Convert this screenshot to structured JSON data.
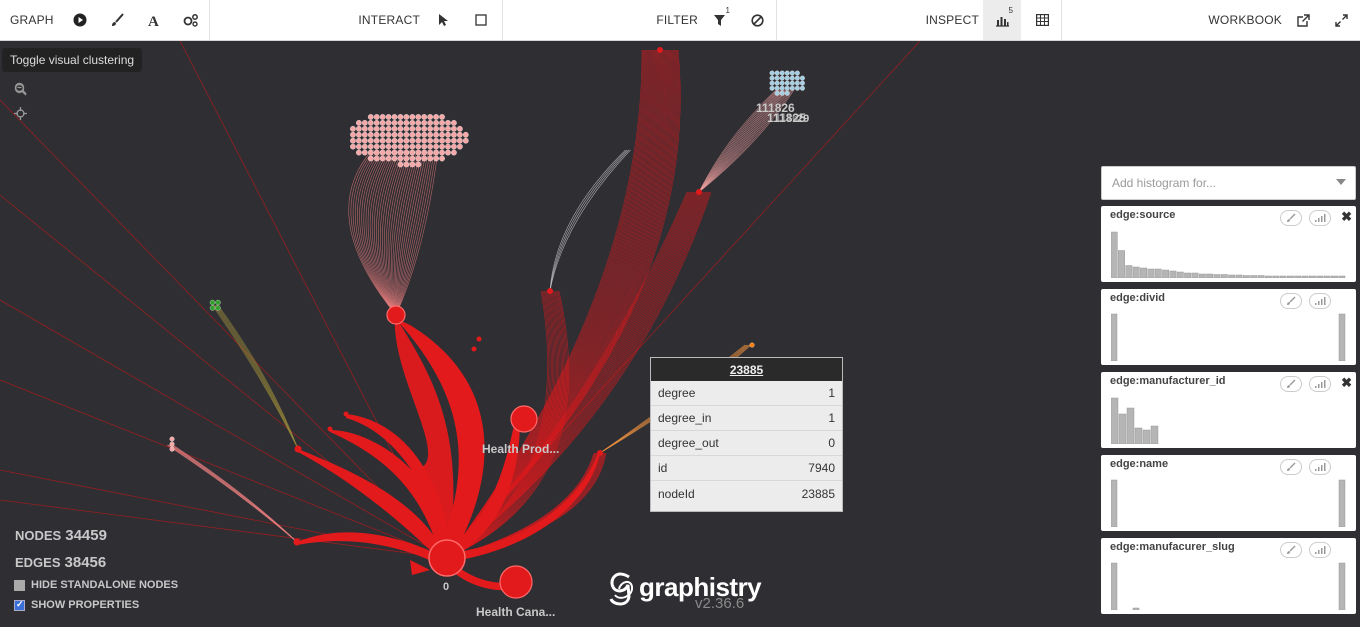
{
  "toolbar": {
    "graph_label": "GRAPH",
    "interact_label": "INTERACT",
    "filter_label": "FILTER",
    "filter_count": "1",
    "inspect_label": "INSPECT",
    "inspect_count": "5",
    "workbook_label": "WORKBOOK"
  },
  "tooltip": "Toggle visual clustering",
  "node_labels": {
    "health_prod": "Health Prod...",
    "health_cana": "Health Cana...",
    "zero": "0",
    "cluster_a": "111826",
    "cluster_b": "111825",
    "cluster_c": "1116",
    "cluster_d": "29"
  },
  "stats": {
    "nodes_label": "NODES",
    "nodes_value": "34459",
    "edges_label": "EDGES",
    "edges_value": "38456",
    "hide_standalone": "HIDE STANDALONE NODES",
    "show_properties": "SHOW PROPERTIES"
  },
  "popup": {
    "title": "23885",
    "rows": [
      {
        "key": "degree",
        "value": "1"
      },
      {
        "key": "degree_in",
        "value": "1"
      },
      {
        "key": "degree_out",
        "value": "0"
      },
      {
        "key": "id",
        "value": "7940"
      },
      {
        "key": "nodeId",
        "value": "23885"
      }
    ]
  },
  "logo": {
    "text": "graphistry",
    "version": "v2.36.6"
  },
  "histogram_panel": {
    "placeholder": "Add histogram for...",
    "histograms": [
      {
        "title": "edge:source",
        "closable": true,
        "bars": [
          0.92,
          0.55,
          0.25,
          0.22,
          0.2,
          0.18,
          0.18,
          0.16,
          0.14,
          0.12,
          0.1,
          0.1,
          0.08,
          0.08,
          0.07,
          0.07,
          0.06,
          0.06,
          0.05,
          0.05,
          0.05,
          0.04,
          0.04,
          0.04,
          0.04,
          0.04,
          0.04,
          0.04,
          0.04,
          0.04,
          0.04,
          0.04
        ]
      },
      {
        "title": "edge:divid",
        "closable": false,
        "bars": [
          0.94,
          0.94
        ]
      },
      {
        "title": "edge:manufacturer_id",
        "closable": true,
        "bars": [
          0.92,
          0.6,
          0.72,
          0.32,
          0.28,
          0.36
        ]
      },
      {
        "title": "edge:name",
        "closable": false,
        "bars": [
          0.94,
          0.94
        ]
      },
      {
        "title": "edge:manufacurer_slug",
        "closable": false,
        "bars": [
          0.94,
          0.04,
          0.94
        ]
      }
    ]
  },
  "colors": {
    "edge": "#e31a1c",
    "canvas": "#2e2e33",
    "cluster_pink": "#f4a8a8",
    "cluster_blue": "#a6cee3",
    "cluster_green": "#33a02c",
    "cluster_orange": "#ff7f00"
  }
}
